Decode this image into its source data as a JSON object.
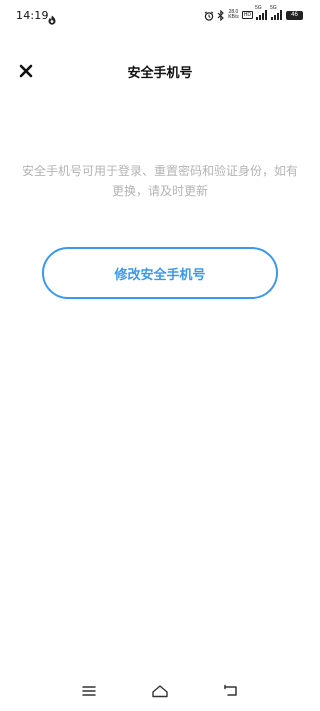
{
  "status_bar": {
    "time": "14:19",
    "app_icon": "notification-app-icon",
    "alarm_icon": "alarm-clock-icon",
    "bluetooth_icon": "bluetooth-icon",
    "net_speed_value": "28.0",
    "net_speed_unit": "KB/s",
    "hd_label": "HD",
    "sim1_label": "5G",
    "sim2_label": "5G",
    "battery_level": "46"
  },
  "header": {
    "title": "安全手机号",
    "close_icon": "close-icon"
  },
  "main": {
    "description": "安全手机号可用于登录、重置密码和验证身份，如有更换，请及时更新",
    "primary_button_label": "修改安全手机号"
  },
  "nav_bar": {
    "menu_icon": "menu-icon",
    "home_icon": "home-icon",
    "back_icon": "back-icon"
  },
  "colors": {
    "accent": "#3d98e8",
    "description_text": "#b4b4b4",
    "title_text": "#111111",
    "background": "#ffffff"
  }
}
